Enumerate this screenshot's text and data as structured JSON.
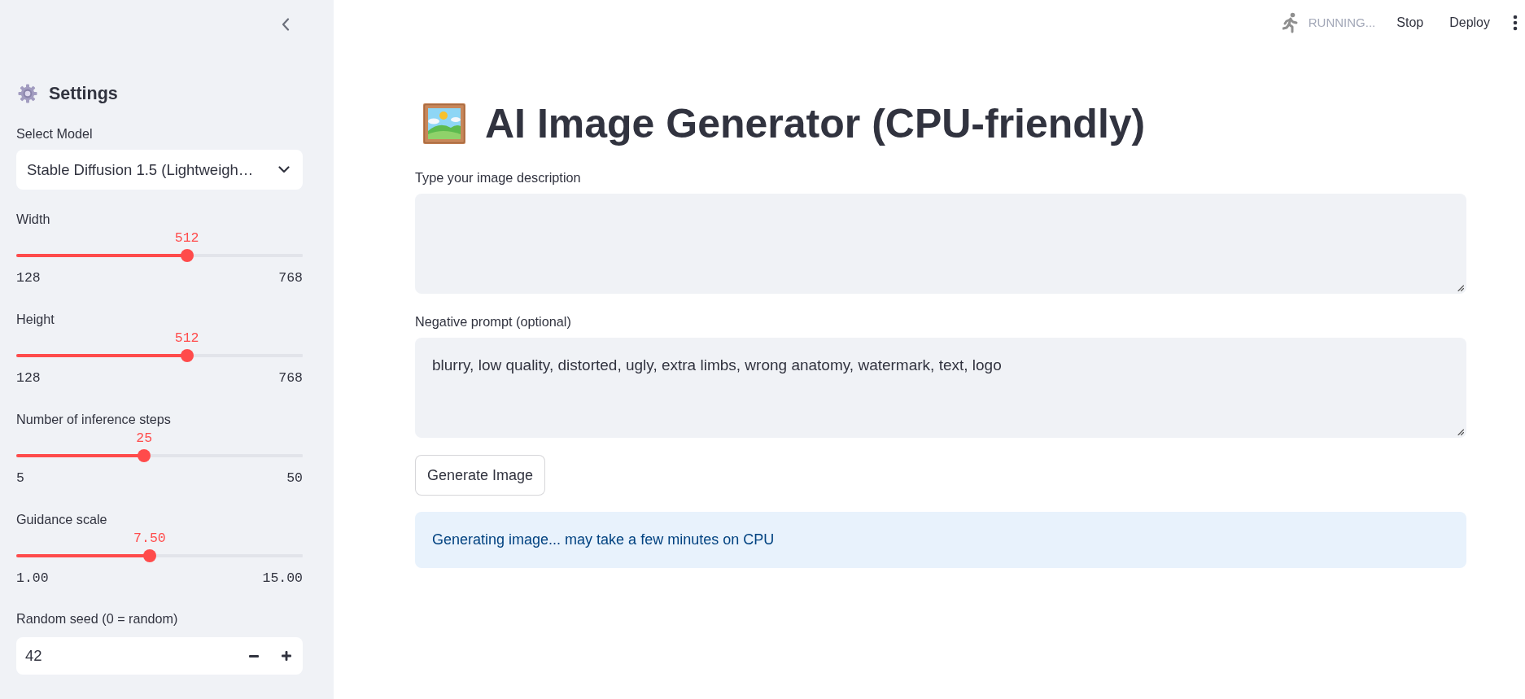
{
  "sidebar": {
    "title": "Settings",
    "model_select": {
      "label": "Select Model",
      "value": "Stable Diffusion 1.5 (Lightweigh…"
    },
    "sliders": [
      {
        "label": "Width",
        "value": "512",
        "min": "128",
        "max": "768",
        "level": 0.6
      },
      {
        "label": "Height",
        "value": "512",
        "min": "128",
        "max": "768",
        "level": 0.6
      },
      {
        "label": "Number of inference steps",
        "value": "25",
        "min": "5",
        "max": "50",
        "level": 0.444
      },
      {
        "label": "Guidance scale",
        "value": "7.50",
        "min": "1.00",
        "max": "15.00",
        "level": 0.464
      }
    ],
    "seed_input": {
      "label": "Random seed (0 = random)",
      "value": "42"
    }
  },
  "header": {
    "status": "RUNNING...",
    "buttons": [
      "Stop",
      "Deploy"
    ]
  },
  "main": {
    "title": "AI Image Generator (CPU-friendly)",
    "text_areas": [
      {
        "label": "Type your image description"
      },
      {
        "label": "Negative prompt (optional)",
        "value": "blurry, low quality, distorted, ugly, extra limbs, wrong anatomy, watermark, text, logo"
      }
    ],
    "button": "Generate Image",
    "info": "Generating image... may take a few minutes on CPU"
  }
}
